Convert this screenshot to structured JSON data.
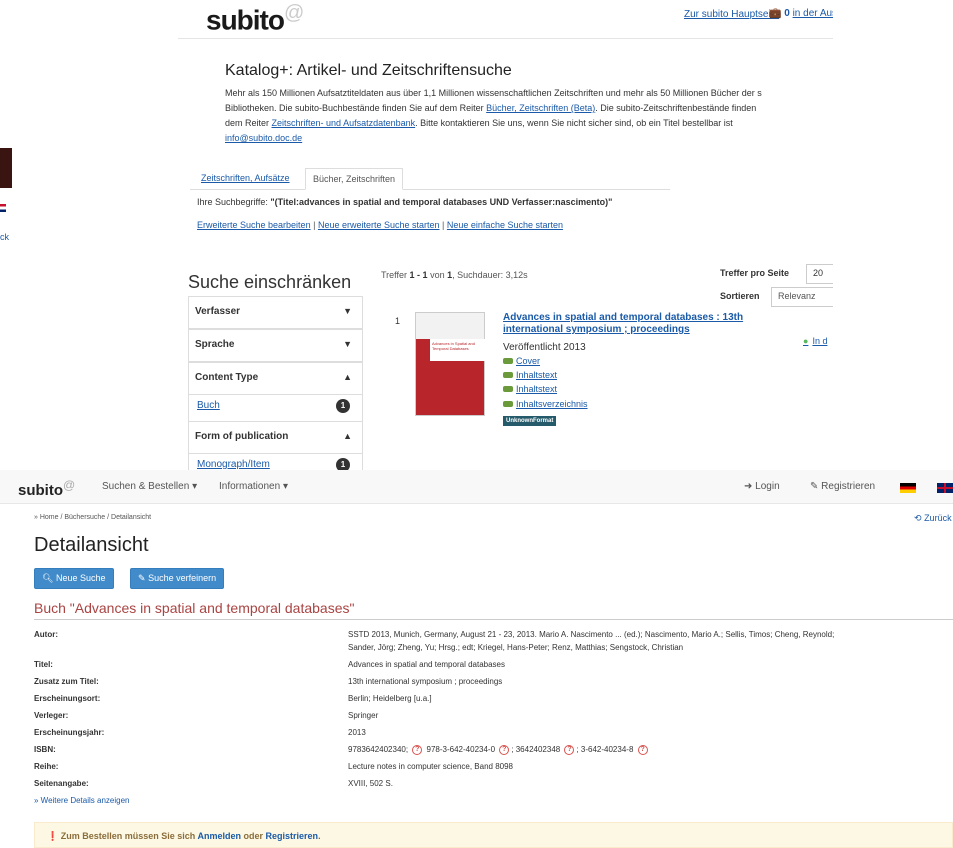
{
  "catalog": {
    "logo": "subito",
    "logo_sup": "@",
    "top_link": "Zur subito Hauptseite",
    "cart_count": "0",
    "cart_text": "in der Aus",
    "title": "Katalog+: Artikel- und Zeitschriftensuche",
    "desc_1": "Mehr als 150 Millionen Aufsatztiteldaten aus über 1,1 Millionen wissenschaftlichen Zeitschriften und mehr als 50 Millionen Bücher der s",
    "desc_2a": "Bibliotheken. Die subito-Buchbestände finden Sie auf dem Reiter ",
    "desc_2_link": "Bücher, Zeitschriften (Beta)",
    "desc_2b": ". Die subito-Zeitschriftenbestände finden",
    "desc_3a": "dem Reiter ",
    "desc_3_link": "Zeitschriften- und Aufsatzdatenbank",
    "desc_3b": ". Bitte kontaktieren Sie uns, wenn Sie nicht sicher sind, ob ein Titel bestellbar ist",
    "desc_email": "info@subito.doc.de",
    "tabs": [
      "Zeitschriften, Aufsätze",
      "Bücher, Zeitschriften"
    ],
    "search_terms_label": "Ihre Suchbegriffe:",
    "search_terms_value": "\"(Titel:advances in spatial and temporal databases UND Verfasser:nascimento)\"",
    "link_edit_advanced": "Erweiterte Suche bearbeiten",
    "link_new_advanced": "Neue erweiterte Suche starten",
    "link_new_simple": "Neue einfache Suche starten",
    "filter_heading": "Suche einschränken",
    "facets": {
      "author": "Verfasser",
      "language": "Sprache",
      "content_type": "Content Type",
      "content_type_value": "Buch",
      "content_type_count": "1",
      "form": "Form of publication",
      "form_value": "Monograph/Item",
      "form_count": "1"
    },
    "hits_prefix": "Treffer",
    "hits_range": "1 - 1",
    "hits_of": "von",
    "hits_total": "1",
    "hits_duration": ", Suchdauer: 3,12s",
    "per_page_label": "Treffer pro Seite",
    "per_page_value": "20",
    "sort_label": "Sortieren",
    "sort_value": "Relevanz",
    "result": {
      "number": "1",
      "title": "Advances in spatial and temporal databases : 13th international symposium ; proceedings",
      "published": "Veröffentlicht 2013",
      "links": [
        "Cover",
        "Inhaltstext",
        "Inhaltstext",
        "Inhaltsverzeichnis"
      ],
      "format": "UnknownFormat",
      "availability": "In d",
      "cover_title": "Advances in Spatial and Temporal Databases"
    }
  },
  "main": {
    "logo": "subito",
    "logo_sup": "@",
    "nav": {
      "search_order": "Suchen & Bestellen",
      "info": "Informationen",
      "login": "Login",
      "register": "Registrieren"
    },
    "breadcrumb": "» Home / Büchersuche / Detailansicht",
    "back": "Zurück",
    "page_title": "Detailansicht",
    "btn_new_search": "Neue Suche",
    "btn_refine": "Suche verfeinern",
    "book_heading": "Buch \"Advances in spatial and temporal databases\"",
    "details": [
      {
        "label": "Autor:",
        "value": "SSTD 2013, Munich, Germany, August 21 - 23, 2013. Mario A. Nascimento ... (ed.); Nascimento, Mario A.; Sellis, Timos; Cheng, Reynold;",
        "value2": "Sander, Jörg; Zheng, Yu; Hrsg.; edt; Kriegel, Hans-Peter; Renz, Matthias; Sengstock, Christian"
      },
      {
        "label": "Titel:",
        "value": "Advances in spatial and temporal databases"
      },
      {
        "label": "Zusatz zum Titel:",
        "value": "13th international symposium ; proceedings"
      },
      {
        "label": "Erscheinungsort:",
        "value": "Berlin; Heidelberg [u.a.]"
      },
      {
        "label": "Verleger:",
        "value": "Springer"
      },
      {
        "label": "Erscheinungsjahr:",
        "value": "2013"
      },
      {
        "label": "ISBN:",
        "isbn": [
          "9783642402340",
          "978-3-642-40234-0",
          "3642402348",
          "3-642-40234-8"
        ]
      },
      {
        "label": "Reihe:",
        "value": "Lecture notes in computer science, Band 8098"
      },
      {
        "label": "Seitenangabe:",
        "value": "XVIII, 502 S."
      }
    ],
    "more_details": "» Weitere Details anzeigen",
    "alert_text": "Zum Bestellen müssen Sie sich",
    "alert_login": "Anmelden",
    "alert_or": "oder",
    "alert_register": "Registrieren",
    "alert_end": ".",
    "left_text": "ck"
  },
  "colors": {
    "link": "#1a5aa8",
    "button": "#428bca",
    "heading_red": "#a94442",
    "alert_bg": "#fcf8e3"
  }
}
